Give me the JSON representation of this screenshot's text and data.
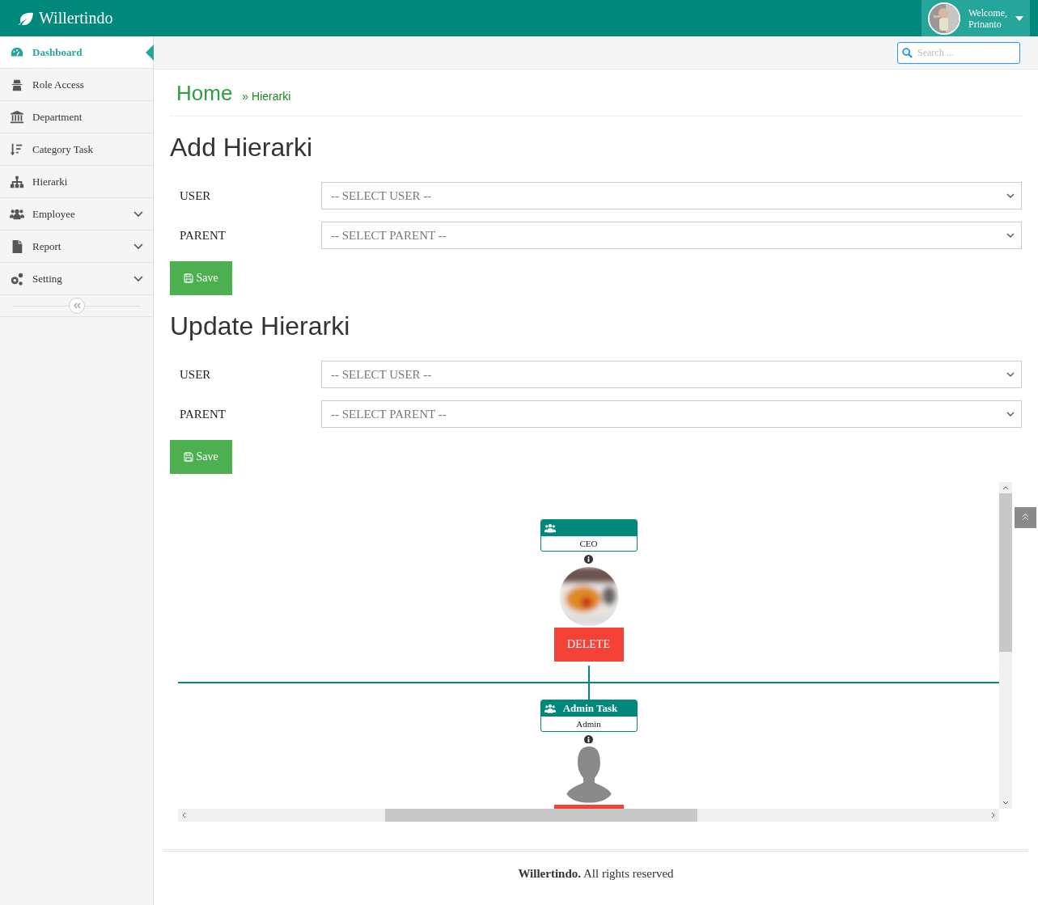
{
  "brand": "Willertindo",
  "user": {
    "greeting": "Welcome,",
    "name": "Prinanto"
  },
  "search": {
    "placeholder": "Search ..."
  },
  "sidebar": {
    "items": [
      {
        "label": "Dashboard",
        "selected": true,
        "expandable": false
      },
      {
        "label": "Role Access",
        "selected": false,
        "expandable": false
      },
      {
        "label": "Department",
        "selected": false,
        "expandable": false
      },
      {
        "label": "Category Task",
        "selected": false,
        "expandable": false
      },
      {
        "label": "Hierarki",
        "selected": false,
        "expandable": false
      },
      {
        "label": "Employee",
        "selected": false,
        "expandable": true
      },
      {
        "label": "Report",
        "selected": false,
        "expandable": true
      },
      {
        "label": "Setting",
        "selected": false,
        "expandable": true
      }
    ]
  },
  "breadcrumb": {
    "home": "Home",
    "current": "» Hierarki"
  },
  "forms": [
    {
      "title": "Add Hierarki",
      "fields": [
        {
          "label": "USER",
          "placeholder": "-- SELECT USER --"
        },
        {
          "label": "PARENT",
          "placeholder": "-- SELECT PARENT --"
        }
      ],
      "button": "Save"
    },
    {
      "title": "Update Hierarki",
      "fields": [
        {
          "label": "USER",
          "placeholder": "-- SELECT USER --"
        },
        {
          "label": "PARENT",
          "placeholder": "-- SELECT PARENT --"
        }
      ],
      "button": "Save"
    }
  ],
  "tree": {
    "nodes": [
      {
        "subtitle": "CEO",
        "kind": "picture",
        "delete": {
          "label": "DELETE",
          "cut": false
        }
      },
      {
        "title": "Admin Task",
        "subtitle": "Admin",
        "kind": "silhouette",
        "delete": {
          "cut": true
        }
      }
    ]
  },
  "footer": "**Willertindo.** All rights reserved"
}
